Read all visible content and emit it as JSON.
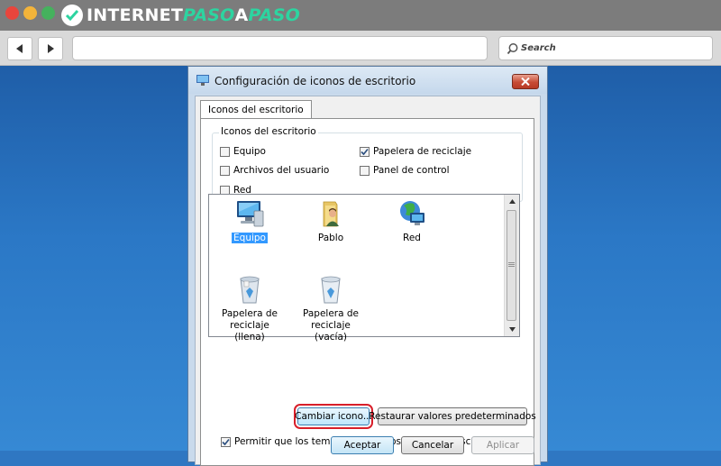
{
  "browser": {
    "brand_part1": "INTERNET",
    "brand_part2": "PASO",
    "brand_part3": "A",
    "brand_part4": "PASO",
    "search_placeholder": "Search",
    "back_icon": "back-arrow-icon",
    "forward_icon": "forward-arrow-icon",
    "colors": {
      "close": "#e8453c",
      "minimize": "#f3b43a",
      "maximize": "#45b25d",
      "brand_accent": "#2dd4a0"
    }
  },
  "dialog": {
    "title": "Configuración de iconos de escritorio",
    "tab_label": "Iconos del escritorio",
    "group_label": "Iconos del escritorio",
    "checkboxes": [
      {
        "label": "Equipo",
        "checked": false
      },
      {
        "label": "Papelera de reciclaje",
        "checked": true
      },
      {
        "label": "Archivos del usuario",
        "checked": false
      },
      {
        "label": "Panel de control",
        "checked": false
      },
      {
        "label": "Red",
        "checked": false
      }
    ],
    "icons": [
      {
        "label": "Equipo",
        "selected": true,
        "icon": "computer-icon"
      },
      {
        "label": "Pablo",
        "selected": false,
        "icon": "user-folder-icon"
      },
      {
        "label": "Red",
        "selected": false,
        "icon": "network-icon"
      },
      {
        "label": "Papelera de reciclaje (llena)",
        "selected": false,
        "icon": "recycle-bin-full-icon"
      },
      {
        "label": "Papelera de reciclaje (vacía)",
        "selected": false,
        "icon": "recycle-bin-empty-icon"
      }
    ],
    "change_icon_button": "Cambiar icono...",
    "restore_defaults_button": "Restaurar valores predeterminados",
    "allow_themes": {
      "label": "Permitir que los temas cambien los iconos del escritorio",
      "checked": true
    },
    "ok_button": "Aceptar",
    "cancel_button": "Cancelar",
    "apply_button": "Aplicar"
  }
}
